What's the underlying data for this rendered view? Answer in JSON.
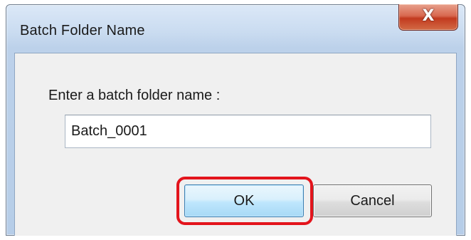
{
  "dialog": {
    "title": "Batch Folder Name",
    "close_icon": "close-icon",
    "close_glyph": "X",
    "prompt": "Enter a batch folder name :",
    "input_value": "Batch_0001",
    "ok_label": "OK",
    "cancel_label": "Cancel"
  },
  "colors": {
    "highlight": "#e3141c",
    "close_button": "#c23a1f"
  }
}
